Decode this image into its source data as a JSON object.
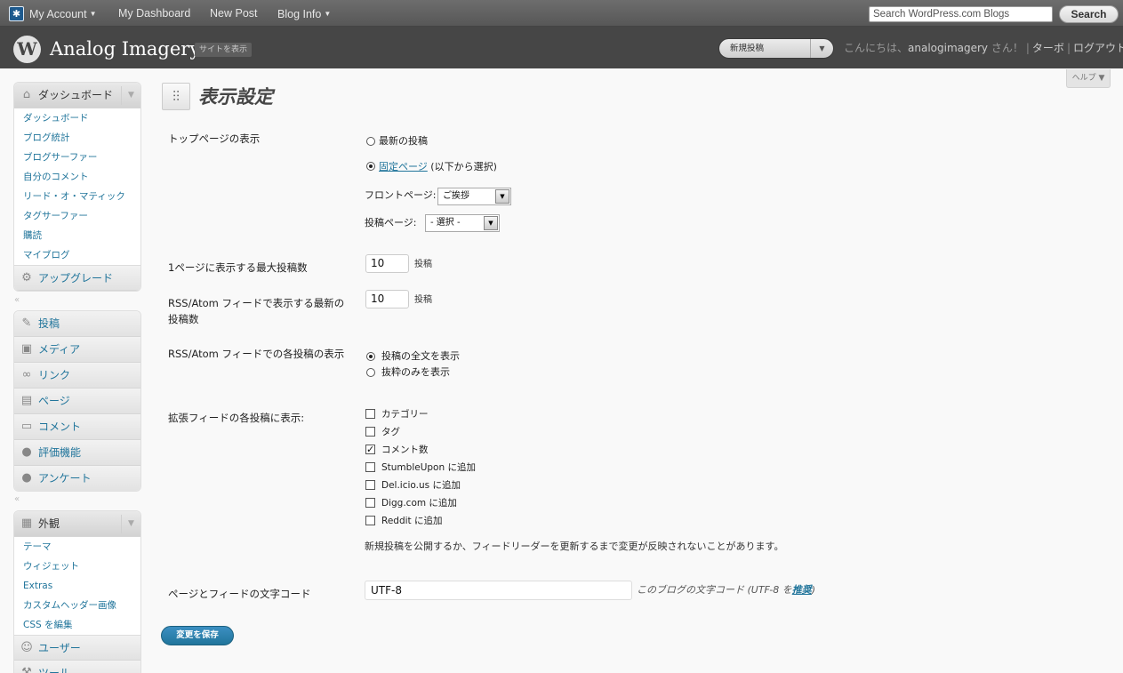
{
  "admin_bar": {
    "my_account": "My Account",
    "my_dashboard": "My Dashboard",
    "new_post": "New Post",
    "blog_info": "Blog Info",
    "search_placeholder": "Search WordPress.com Blogs",
    "search_button": "Search"
  },
  "header": {
    "site_title": "Analog Imagery",
    "view_site": "サイトを表示",
    "favorite_action": "新規投稿",
    "greeting": "こんにちは、",
    "username": "analogimagery",
    "greeting_suffix": " さん！",
    "turbo": "ターボ",
    "logout": "ログアウト"
  },
  "help_tab": "ヘルプ",
  "sidebar": {
    "dashboard_group": {
      "label": "ダッシュボード",
      "items": [
        "ダッシュボード",
        "ブログ統計",
        "ブログサーファー",
        "自分のコメント",
        "リード・オ・マティック",
        "タグサーファー",
        "購読",
        "マイブログ"
      ]
    },
    "upgrade": "アップグレード",
    "content_menu": [
      "投稿",
      "メディア",
      "リンク",
      "ページ",
      "コメント",
      "評価機能",
      "アンケート"
    ],
    "appearance_group": {
      "label": "外観",
      "items": [
        "テーマ",
        "ウィジェット",
        "Extras",
        "カスタムヘッダー画像",
        "CSS を編集"
      ]
    },
    "users": "ユーザー",
    "tools": "ツール"
  },
  "page": {
    "title": "表示設定",
    "front_page": {
      "label": "トップページの表示",
      "opt_latest": "最新の投稿",
      "opt_static_link": "固定ページ",
      "opt_static_suffix": " (以下から選択)",
      "front_label": "フロントページ:",
      "front_value": "ご挨拶",
      "posts_label": "投稿ページ:",
      "posts_value": "- 選択 -"
    },
    "posts_per_page": {
      "label": "1ページに表示する最大投稿数",
      "value": "10",
      "unit": "投稿"
    },
    "posts_per_rss": {
      "label": "RSS/Atom フィードで表示する最新の投稿数",
      "value": "10",
      "unit": "投稿"
    },
    "rss_use_excerpt": {
      "label": "RSS/Atom フィードでの各投稿の表示",
      "opt_full": "投稿の全文を表示",
      "opt_summary": "抜粋のみを表示"
    },
    "extended_feed": {
      "label": "拡張フィードの各投稿に表示:",
      "items": [
        "カテゴリー",
        "タグ",
        "コメント数",
        "StumbleUpon に追加",
        "Del.icio.us に追加",
        "Digg.com に追加",
        "Reddit に追加"
      ],
      "checked": [
        false,
        false,
        true,
        false,
        false,
        false,
        false
      ],
      "note": "新規投稿を公開するか、フィードリーダーを更新するまで変更が反映されないことがあります。"
    },
    "charset": {
      "label": "ページとフィードの文字コード",
      "value": "UTF-8",
      "note_prefix": "このブログの文字コード (UTF-8 を",
      "note_link": "推奨",
      "note_suffix": ")"
    },
    "save_button": "変更を保存"
  }
}
